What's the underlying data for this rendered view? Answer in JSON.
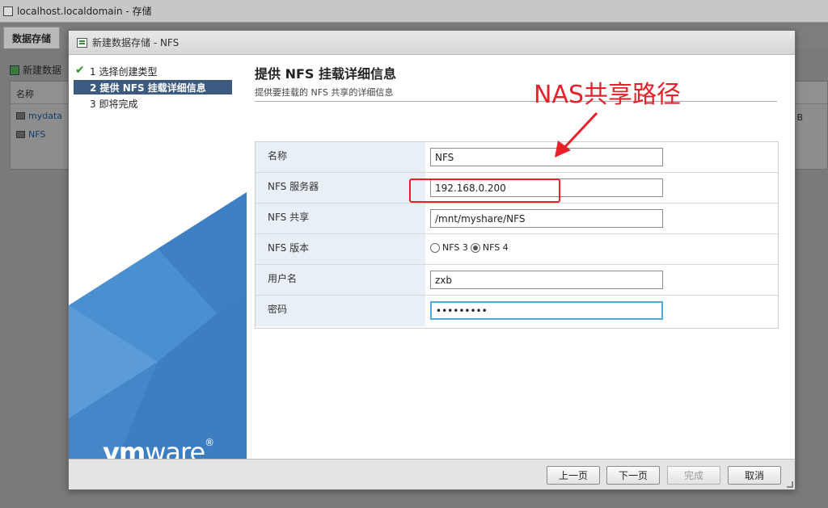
{
  "background": {
    "window_title": "localhost.localdomain - 存储",
    "tab_label": "数据存储",
    "toolbar_label": "新建数据",
    "table_header": "名称",
    "rows": [
      "mydata",
      "NFS"
    ],
    "gb_fragment": "B"
  },
  "dialog": {
    "title": "新建数据存储 - NFS",
    "steps": [
      {
        "label": "1 选择创建类型",
        "state": "done"
      },
      {
        "label": "2 提供 NFS 挂载详细信息",
        "state": "active"
      },
      {
        "label": "3 即将完成",
        "state": "pending"
      }
    ],
    "brand": {
      "bold": "vm",
      "regular": "ware",
      "mark": "®"
    },
    "heading": "提供 NFS 挂载详细信息",
    "subheading": "提供要挂载的 NFS 共享的详细信息",
    "form": {
      "name_label": "名称",
      "name_value": "NFS",
      "server_label": "NFS 服务器",
      "server_value": "192.168.0.200",
      "share_label": "NFS 共享",
      "share_value": "/mnt/myshare/NFS",
      "version_label": "NFS 版本",
      "version_options": [
        "NFS 3",
        "NFS 4"
      ],
      "version_selected": "NFS 4",
      "user_label": "用户名",
      "user_value": "zxb",
      "password_label": "密码",
      "password_value": "•••••••••"
    },
    "buttons": {
      "back": "上一页",
      "next": "下一页",
      "finish": "完成",
      "cancel": "取消"
    }
  },
  "annotation": {
    "text": "NAS共享路径",
    "color": "#e8202a"
  }
}
